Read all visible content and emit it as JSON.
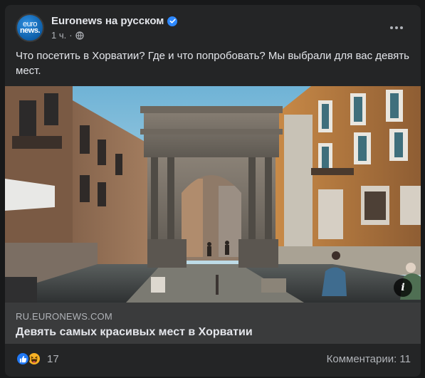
{
  "post": {
    "page_name": "Euronews на русском",
    "avatar_text": [
      "euro",
      "news."
    ],
    "time": "1 ч.",
    "separator": "·",
    "caption": "Что посетить в Хорватии? Где и что попробовать? Мы выбрали для вас девять мест.",
    "verified_icon": "verified-badge-icon",
    "privacy_icon": "globe-icon",
    "more_icon": "more-options-icon"
  },
  "link": {
    "domain": "RU.EURONEWS.COM",
    "title": "Девять самых красивых мест в Хорватии",
    "info_icon": "info-icon",
    "info_glyph": "i"
  },
  "footer": {
    "reaction_icons": [
      "like-icon",
      "haha-icon"
    ],
    "reaction_count": "17",
    "comments": "Комментарии: 11"
  },
  "colors": {
    "background": "#18191a",
    "card": "#242526",
    "link_box": "#3a3b3c",
    "primary_text": "#e4e6eb",
    "secondary_text": "#b0b3b8",
    "accent": "#2d88ff"
  }
}
